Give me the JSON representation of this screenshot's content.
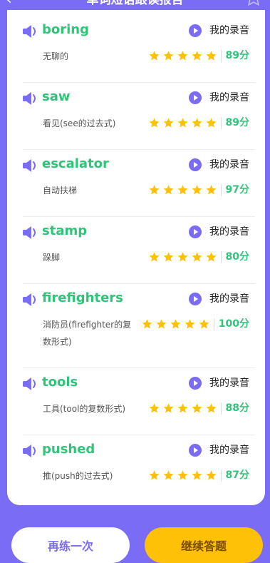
{
  "header": {
    "title": "单词短语跟读报告"
  },
  "recording_label": "我的录音",
  "items": [
    {
      "word": "boring",
      "meaning": "无聊的",
      "score": "89分",
      "stars": 5
    },
    {
      "word": "saw",
      "meaning": "看见(see的过去式)",
      "score": "89分",
      "stars": 5
    },
    {
      "word": "escalator",
      "meaning": "自动扶梯",
      "score": "97分",
      "stars": 5
    },
    {
      "word": "stamp",
      "meaning": "跺脚",
      "score": "80分",
      "stars": 5
    },
    {
      "word": "firefighters",
      "meaning": "消防员(firefighter的复数形式)",
      "score": "100分",
      "stars": 5
    },
    {
      "word": "tools",
      "meaning": "工具(tool的复数形式)",
      "score": "88分",
      "stars": 5
    },
    {
      "word": "pushed",
      "meaning": "推(push的过去式)",
      "score": "87分",
      "stars": 5
    }
  ],
  "buttons": {
    "again": "再练一次",
    "continue": "继续答题"
  },
  "colors": {
    "accent": "#7B6CF6",
    "word_green": "#2FC478",
    "star": "#FFC107",
    "continue_button": "#FFC107"
  },
  "icons": {
    "back": "chevron-left-icon",
    "speaker": "speaker-icon",
    "play": "play-icon",
    "star": "star-icon"
  }
}
